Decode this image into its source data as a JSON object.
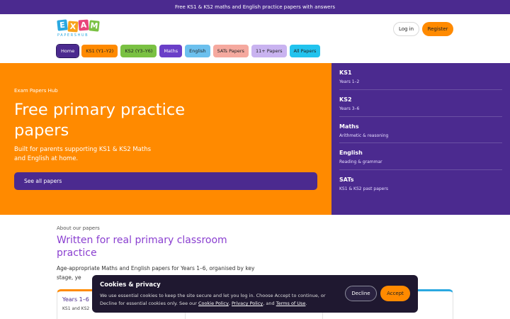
{
  "topbar": {
    "text": "Free KS1 & KS2 maths and English practice papers with answers"
  },
  "logo": {
    "letters": [
      "E",
      "X",
      "A",
      "M"
    ],
    "sub": "PAPERSHUB"
  },
  "header": {
    "login": "Log in",
    "register": "Register"
  },
  "nav": {
    "items": [
      {
        "label": "Home",
        "color": "#4b2a8f"
      },
      {
        "label": "KS1 (Y1–Y2)",
        "color": "#ff8a00"
      },
      {
        "label": "KS2 (Y3–Y6)",
        "color": "#7ac143"
      },
      {
        "label": "Maths",
        "color": "#6a3fc8"
      },
      {
        "label": "English",
        "color": "#6cc0ee"
      },
      {
        "label": "SATs Papers",
        "color": "#f5a99f"
      },
      {
        "label": "11+ Papers",
        "color": "#c9b3f0"
      },
      {
        "label": "All Papers",
        "color": "#22c3ee"
      }
    ]
  },
  "hero": {
    "kicker": "Exam Papers Hub",
    "title": "Free primary practice papers",
    "subtitle": "Built for parents supporting KS1 & KS2 Maths and English at home.",
    "cta": "See all papers"
  },
  "side": {
    "items": [
      {
        "title": "KS1",
        "sub": "Years 1–2"
      },
      {
        "title": "KS2",
        "sub": "Years 3–6"
      },
      {
        "title": "Maths",
        "sub": "Arithmetic & reasoning"
      },
      {
        "title": "English",
        "sub": "Reading & grammar"
      },
      {
        "title": "SATs",
        "sub": "KS1 & KS2 past papers"
      }
    ]
  },
  "about": {
    "kicker": "About our papers",
    "title": "Written for real primary classroom practice",
    "body": "Age-appropriate Maths and English papers for Years 1–6, organised by key stage, ye"
  },
  "cards": [
    {
      "title": "Years 1–6",
      "sub": "KS1 and KS2"
    }
  ],
  "cookie": {
    "title": "Cookies & privacy",
    "text_before": "We use essential cookies to keep the site secure and let you log in. Choose Accept to continue, or Decline for essential cookies only. See our ",
    "cookie_policy": "Cookie Policy",
    "sep1": ", ",
    "privacy_policy": "Privacy Policy",
    "sep2": ", and ",
    "terms": "Terms of Use",
    "end": ".",
    "decline": "Decline",
    "accept": "Accept"
  },
  "colors": {
    "brand_orange": "#ff8a00",
    "brand_purple": "#4b2a8f",
    "heading_purple": "#8a3fd0"
  }
}
